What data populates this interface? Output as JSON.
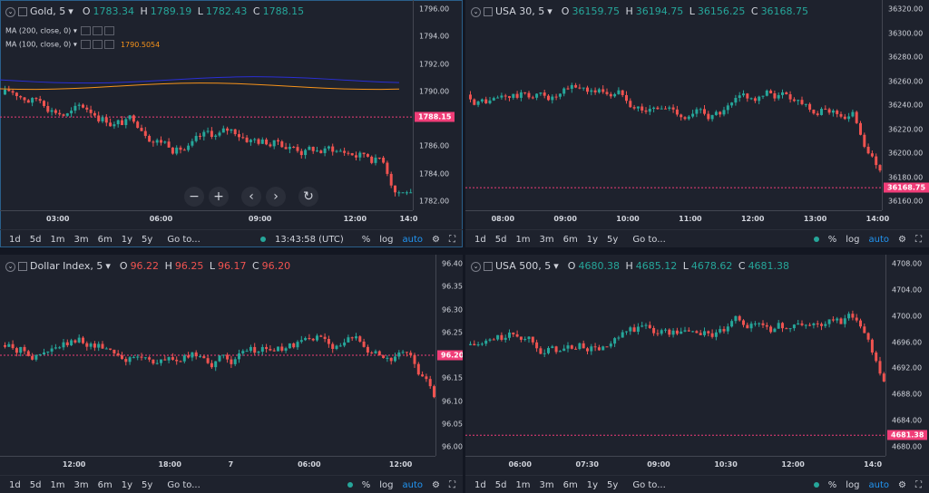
{
  "colors": {
    "up": "#26a69a",
    "down": "#ef5350",
    "price_line": "#f03d78",
    "ma200": "#2a2fd6",
    "ma100": "#f7931a",
    "accent": "#2196f3"
  },
  "charts": [
    {
      "id": "gold",
      "title": "Gold, 5",
      "o_label": "O",
      "o": "1783.34",
      "h_label": "H",
      "h": "1789.19",
      "l_label": "L",
      "l": "1782.43",
      "c_label": "C",
      "c": "1788.15",
      "ohlc_color": "up",
      "indicators": [
        {
          "label": "MA (200, close, 0)",
          "value": ""
        },
        {
          "label": "MA (100, close, 0)",
          "value": "1790.5054"
        }
      ],
      "price": "1788.15",
      "ymin": 1781.5,
      "ymax": 1796.5,
      "yticks": [
        "1796.00",
        "1794.00",
        "1792.00",
        "1790.00",
        "1788.00",
        "1786.00",
        "1784.00",
        "1782.00"
      ],
      "xticks": [
        "03:00",
        "06:00",
        "09:00",
        "12:00",
        "14:0"
      ],
      "candles_summary": {
        "start": 1790.0,
        "end": 1788.15,
        "low": 1783.0,
        "high": 1796.0
      }
    },
    {
      "id": "usa30",
      "title": "USA 30, 5",
      "o_label": "O",
      "o": "36159.75",
      "h_label": "H",
      "h": "36194.75",
      "l_label": "L",
      "l": "36156.25",
      "c_label": "C",
      "c": "36168.75",
      "ohlc_color": "up",
      "price": "36168.75",
      "ymin": 36150,
      "ymax": 36325,
      "yticks": [
        "36320.00",
        "36300.00",
        "36280.00",
        "36260.00",
        "36240.00",
        "36220.00",
        "36200.00",
        "36180.00",
        "36160.00"
      ],
      "xticks": [
        "08:00",
        "09:00",
        "10:00",
        "11:00",
        "12:00",
        "13:00",
        "14:00"
      ]
    },
    {
      "id": "dxy",
      "title": "Dollar Index, 5",
      "o_label": "O",
      "o": "96.22",
      "h_label": "H",
      "h": "96.25",
      "l_label": "L",
      "l": "96.17",
      "c_label": "C",
      "c": "96.20",
      "ohlc_color": "down",
      "price": "96.20",
      "ymin": 96.0,
      "ymax": 96.4,
      "yticks": [
        "96.40",
        "96.35",
        "96.30",
        "96.25",
        "96.20",
        "96.15",
        "96.10",
        "96.05",
        "96.00"
      ],
      "xticks": [
        "12:00",
        "18:00",
        "7",
        "06:00",
        "12:00"
      ]
    },
    {
      "id": "usa500",
      "title": "USA 500, 5",
      "o_label": "O",
      "o": "4680.38",
      "h_label": "H",
      "h": "4685.12",
      "l_label": "L",
      "l": "4678.62",
      "c_label": "C",
      "c": "4681.38",
      "ohlc_color": "up",
      "price": "4681.38",
      "ymin": 4678,
      "ymax": 4711,
      "yticks": [
        "4708.00",
        "4704.00",
        "4700.00",
        "4696.00",
        "4692.00",
        "4688.00",
        "4684.00",
        "4680.00"
      ],
      "xticks": [
        "06:00",
        "07:30",
        "09:00",
        "10:30",
        "12:00",
        "14:0"
      ]
    }
  ],
  "toolbar": {
    "ranges": [
      "1d",
      "5d",
      "1m",
      "3m",
      "6m",
      "1y",
      "5y"
    ],
    "goto": "Go to...",
    "time": "13:43:58 (UTC)",
    "pct": "%",
    "log": "log",
    "auto": "auto"
  }
}
